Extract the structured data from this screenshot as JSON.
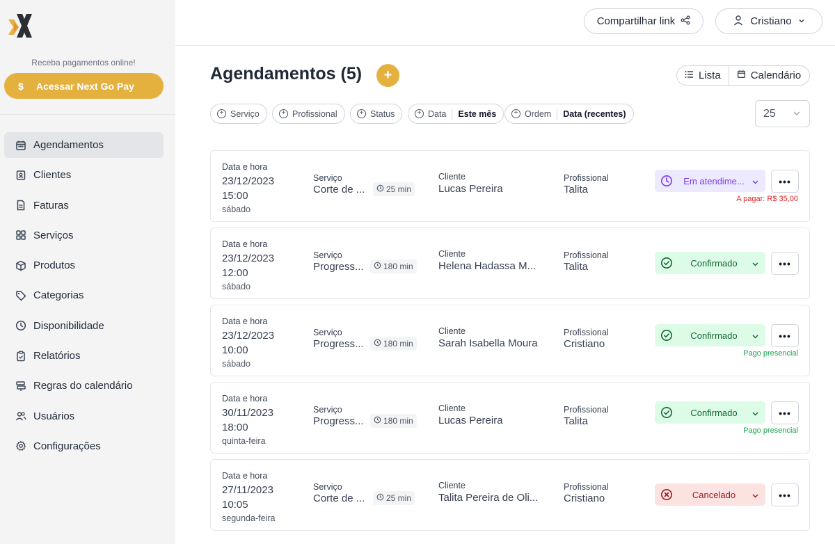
{
  "sidebar": {
    "promo_text": "Receba pagamentos online!",
    "pay_button": "Acessar Next Go Pay",
    "pay_button_icon": "$",
    "items": [
      {
        "label": "Agendamentos",
        "icon": "calendar-icon",
        "active": true
      },
      {
        "label": "Clientes",
        "icon": "contact-card-icon"
      },
      {
        "label": "Faturas",
        "icon": "document-icon"
      },
      {
        "label": "Serviços",
        "icon": "grid-icon"
      },
      {
        "label": "Produtos",
        "icon": "package-icon"
      },
      {
        "label": "Categorias",
        "icon": "tag-icon"
      },
      {
        "label": "Disponibilidade",
        "icon": "clock-icon"
      },
      {
        "label": "Relatórios",
        "icon": "clipboard-icon"
      },
      {
        "label": "Regras do calendário",
        "icon": "signpost-icon"
      },
      {
        "label": "Usuários",
        "icon": "users-icon"
      },
      {
        "label": "Configurações",
        "icon": "gear-icon"
      }
    ]
  },
  "header": {
    "share_label": "Compartilhar link",
    "user_name": "Cristiano"
  },
  "main": {
    "title": "Agendamentos (5)",
    "add_symbol": "+",
    "view_list": "Lista",
    "view_calendar": "Calendário",
    "filters": {
      "service": "Serviço",
      "professional": "Profissional",
      "status": "Status",
      "date_label": "Data",
      "date_value": "Este mês",
      "order_label": "Ordem",
      "order_value": "Data (recentes)"
    },
    "page_size": "25",
    "col_labels": {
      "date": "Data e hora",
      "service": "Serviço",
      "client": "Cliente",
      "professional": "Profissional"
    },
    "more_symbol": "•••",
    "appointments": [
      {
        "date": "23/12/2023",
        "time": "15:00",
        "weekday": "sábado",
        "service": "Corte de ...",
        "duration": "25 min",
        "client": "Lucas Pereira",
        "professional": "Talita",
        "status": "Em atendime...",
        "status_type": "purple",
        "payment_note": "A pagar: R$ 35,00",
        "payment_type": "red"
      },
      {
        "date": "23/12/2023",
        "time": "12:00",
        "weekday": "sábado",
        "service": "Progress...",
        "duration": "180 min",
        "client": "Helena Hadassa M...",
        "professional": "Talita",
        "status": "Confirmado",
        "status_type": "green",
        "payment_note": "",
        "payment_type": ""
      },
      {
        "date": "23/12/2023",
        "time": "10:00",
        "weekday": "sábado",
        "service": "Progress...",
        "duration": "180 min",
        "client": "Sarah Isabella Moura",
        "professional": "Cristiano",
        "status": "Confirmado",
        "status_type": "green",
        "payment_note": "Pago presencial",
        "payment_type": "green"
      },
      {
        "date": "30/11/2023",
        "time": "18:00",
        "weekday": "quinta-feira",
        "service": "Progress...",
        "duration": "180 min",
        "client": "Lucas Pereira",
        "professional": "Talita",
        "status": "Confirmado",
        "status_type": "green",
        "payment_note": "Pago presencial",
        "payment_type": "green"
      },
      {
        "date": "27/11/2023",
        "time": "10:05",
        "weekday": "segunda-feira",
        "service": "Corte de ...",
        "duration": "25 min",
        "client": "Talita Pereira de Oli...",
        "professional": "Cristiano",
        "status": "Cancelado",
        "status_type": "red",
        "payment_note": "",
        "payment_type": ""
      }
    ]
  },
  "colors": {
    "accent": "#e4b13f",
    "status_purple": "#7c3aed",
    "status_green": "#16a34a",
    "status_red": "#dc2626"
  }
}
